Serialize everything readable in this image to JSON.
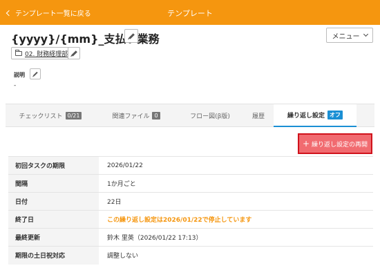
{
  "header": {
    "back_label": "テンプレート一覧に戻る",
    "title": "テンプレート"
  },
  "template": {
    "name": "{yyyy}/{mm}_支払い業務",
    "folder": "02. 財務経理部",
    "description_label": "説明",
    "description_value": "-"
  },
  "menu": {
    "label": "メニュー"
  },
  "tabs": [
    {
      "label": "チェックリスト",
      "badge": "0/21"
    },
    {
      "label": "関連ファイル",
      "badge": "0"
    },
    {
      "label": "フロー図(β版)",
      "badge": ""
    },
    {
      "label": "履歴",
      "badge": ""
    },
    {
      "label": "繰り返し設定",
      "badge": "オフ"
    }
  ],
  "resume_button": {
    "label": "繰り返し設定の再開"
  },
  "settings": [
    {
      "label": "初回タスクの期限",
      "value": "2026/01/22"
    },
    {
      "label": "間隔",
      "value": "1か月ごと"
    },
    {
      "label": "日付",
      "value": "22日"
    },
    {
      "label": "終了日",
      "value": "この繰り返し設定は2026/01/22で停止しています"
    },
    {
      "label": "最終更新",
      "value": "鈴木 里英（2026/01/22 17:13）"
    },
    {
      "label": "期限の土日祝対応",
      "value": "調整しない"
    }
  ],
  "colors": {
    "header_bg": "#f5960f",
    "accent": "#1a8fd4",
    "warning_text": "#f5960f",
    "resume_button_bg": "#f16b70",
    "resume_button_border": "#d0121b"
  },
  "icons": [
    "chevron-left-icon",
    "pencil-icon",
    "folder-icon",
    "chevron-down-icon",
    "plus-icon"
  ]
}
